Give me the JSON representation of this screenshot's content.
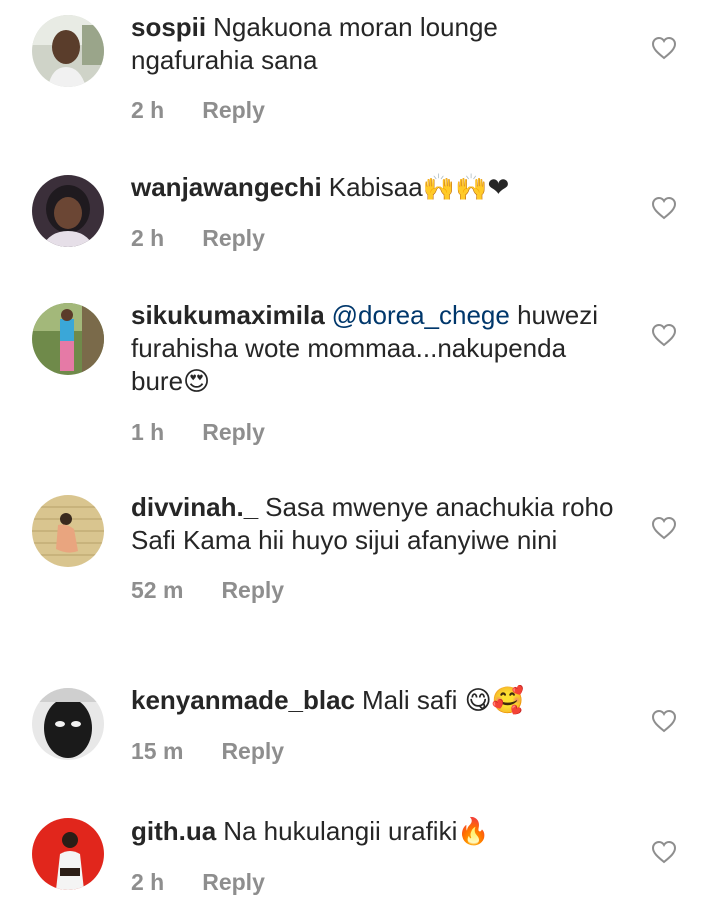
{
  "comments": [
    {
      "username": "sospii",
      "text": "Ngakuona moran lounge ngafurahia sana",
      "mention": "",
      "emoji": "",
      "time": "2 h",
      "reply_label": "Reply",
      "avatar": "avatar-man-outdoor",
      "like_icon": "heart-outline-icon"
    },
    {
      "username": "wanjawangechi",
      "text": "Kabisaa",
      "mention": "",
      "emoji": "🙌🙌❤",
      "time": "2 h",
      "reply_label": "Reply",
      "avatar": "avatar-woman-braids",
      "like_icon": "heart-outline-icon"
    },
    {
      "username": "sikukumaximila",
      "text": "huwezi furahisha wote mommaa...nakupenda bure",
      "mention": "@dorea_chege",
      "emoji": "😍",
      "time": "1 h",
      "reply_label": "Reply",
      "avatar": "avatar-person-garden",
      "like_icon": "heart-outline-icon"
    },
    {
      "username": "divvinah._",
      "text": "Sasa mwenye anachukia roho Safi Kama hii huyo sijui afanyiwe nini",
      "mention": "",
      "emoji": "",
      "time": "52 m",
      "reply_label": "Reply",
      "avatar": "avatar-woman-brick-wall",
      "like_icon": "heart-outline-icon"
    },
    {
      "username": "kenyanmade_blac",
      "text": "Mali safi",
      "mention": "",
      "emoji": "😋🥰",
      "time": "15 m",
      "reply_label": "Reply",
      "avatar": "avatar-man-dark",
      "like_icon": "heart-outline-icon"
    },
    {
      "username": "gith.ua",
      "text": "Na hukulangii urafiki",
      "mention": "",
      "emoji": "🔥",
      "time": "2 h",
      "reply_label": "Reply",
      "avatar": "avatar-woman-red-background",
      "like_icon": "heart-outline-icon"
    }
  ]
}
